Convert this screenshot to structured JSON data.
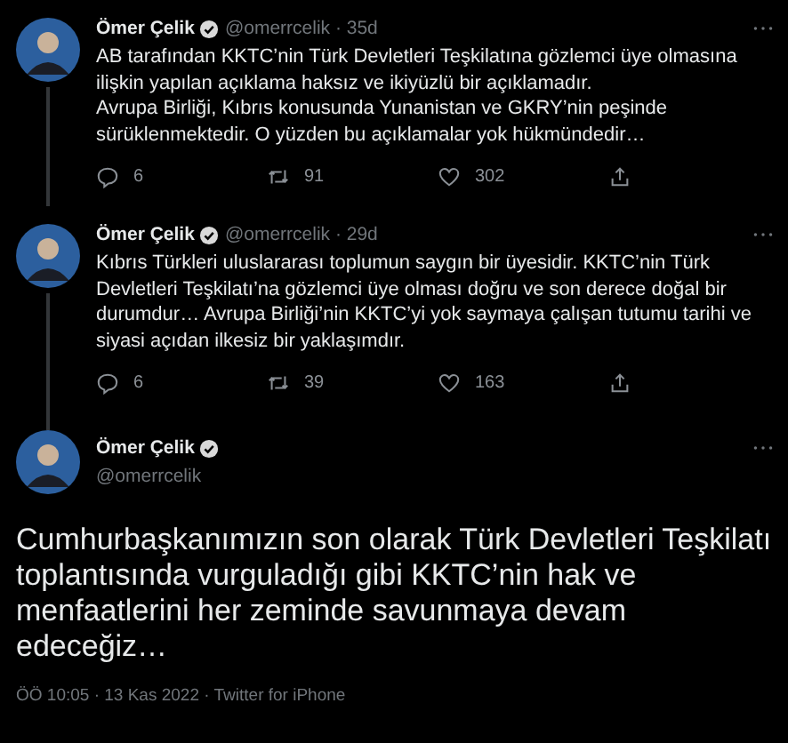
{
  "tweets": [
    {
      "kind": "thread",
      "name": "Ömer Çelik",
      "verified": true,
      "meta": "@omerrcelik · 35d",
      "text": "AB tarafından KKTC’nin Türk Devletleri Teşkilatına gözlemci üye olmasına ilişkin yapılan açıklama haksız ve ikiyüzlü bir açıklamadır.\nAvrupa Birliği, Kıbrıs konusunda Yunanistan ve GKRY’nin peşinde sürüklenmektedir. O yüzden bu açıklamalar yok hükmündedir…",
      "replies": "6",
      "retweets": "91",
      "likes": "302"
    },
    {
      "kind": "thread",
      "name": "Ömer Çelik",
      "verified": true,
      "meta": "@omerrcelik · 29d",
      "text": "Kıbrıs Türkleri uluslararası toplumun saygın bir üyesidir. KKTC’nin Türk Devletleri Teşkilatı’na gözlemci üye olması doğru ve son derece doğal bir durumdur… Avrupa Birliği’nin KKTC’yi yok saymaya çalışan tutumu tarihi ve siyasi açıdan ilkesiz bir yaklaşımdır.",
      "replies": "6",
      "retweets": "39",
      "likes": "163"
    },
    {
      "kind": "focus",
      "name": "Ömer Çelik",
      "verified": true,
      "meta": "@omerrcelik",
      "text": "Cumhurbaşkanımızın son olarak Türk Devletleri Teşkilatı toplantısında vurguladığı gibi KKTC’nin hak ve menfaatlerini her zeminde savunmaya devam edeceğiz…",
      "footer": "ÖÖ 10:05 · 13 Kas 2022 · Twitter for iPhone"
    }
  ]
}
